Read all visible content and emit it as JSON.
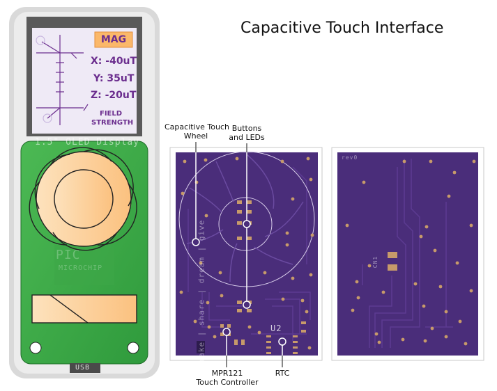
{
  "title": "Capacitive Touch Interface",
  "device": {
    "mode_badge": "MAG",
    "readings": [
      "X: -40uT",
      "Y: 35uT",
      "Z: -20uT"
    ],
    "caption_line1": "FIELD",
    "caption_line2": "STRENGTH",
    "display_label": "1.5\" OLED Display",
    "usb_label": "USB",
    "chip_line1": "PIC",
    "chip_line2": "MICROCHIP"
  },
  "callouts": {
    "touch_wheel_line1": "Capacitive Touch",
    "touch_wheel_line2": "Wheel",
    "buttons_line1": "Buttons",
    "buttons_line2": "and LEDs",
    "mpr_line1": "MPR121",
    "mpr_line2": "Touch Controller",
    "rtc": "RTC"
  },
  "pcb": {
    "front_silk": "make | share | dream | give",
    "u2_label": "U2",
    "rev_label": "rev0",
    "cn1_label": "CN1"
  },
  "colors": {
    "pcb_purple": "#4a2d7a",
    "pcb_trace": "#5a3a8c",
    "device_green": "#3fae49",
    "wheel_peach": "#fcd3a1",
    "screen_bg": "#efeaf6",
    "screen_text": "#6b2d8e",
    "badge": "#fbb86a"
  }
}
